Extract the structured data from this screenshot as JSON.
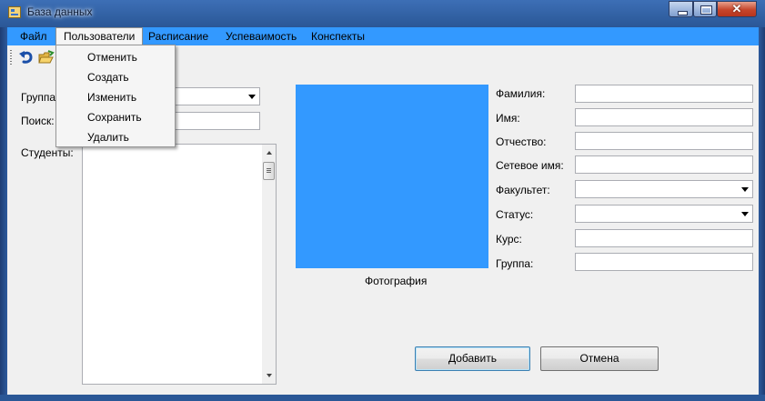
{
  "window": {
    "title": "База данных",
    "app_icon": "database-app-icon",
    "close_glyph": "✕"
  },
  "menu": {
    "items": [
      "Файл",
      "Пользователи",
      "Расписание",
      "Успеваимость",
      "Конспекты"
    ],
    "open_item": "Пользователи",
    "dropdown": [
      "Отменить",
      "Создать",
      "Изменить",
      "Сохранить",
      "Удалить"
    ]
  },
  "toolbar": {
    "icons": [
      "undo-icon",
      "open-folder-icon"
    ]
  },
  "left": {
    "group_label": "Группа",
    "group_value": "",
    "search_label": "Поиск:",
    "search_value": "",
    "students_label": "Студенты:",
    "students": []
  },
  "photo": {
    "caption": "Фотография",
    "color": "#3399ff"
  },
  "form": {
    "fields": [
      {
        "label": "Фамилия:",
        "type": "text",
        "value": ""
      },
      {
        "label": "Имя:",
        "type": "text",
        "value": ""
      },
      {
        "label": "Отчество:",
        "type": "text",
        "value": ""
      },
      {
        "label": "Сетевое имя:",
        "type": "text",
        "value": ""
      },
      {
        "label": "Факультет:",
        "type": "combo",
        "value": ""
      },
      {
        "label": "Статус:",
        "type": "combo",
        "value": ""
      },
      {
        "label": "Курс:",
        "type": "text",
        "value": ""
      },
      {
        "label": "Группа:",
        "type": "text",
        "value": ""
      }
    ]
  },
  "buttons": {
    "add": "Добавить",
    "cancel": "Отмена"
  },
  "colors": {
    "menubar": "#3399ff",
    "accent": "#3399ff",
    "client_bg": "#f0f0f0",
    "frame": "#2a5796"
  }
}
